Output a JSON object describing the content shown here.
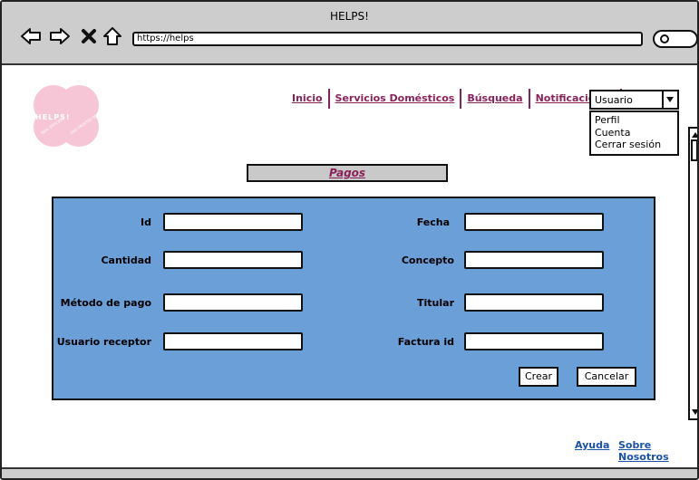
{
  "window": {
    "title": "HELPS!",
    "url": "https://helps"
  },
  "logo": {
    "text": "HELPS!",
    "tagline_left": "REAL EFFICIENT",
    "tagline_right": "AND TRUSTED SERVICE",
    "color": "#f7c6d6"
  },
  "nav": {
    "items": [
      {
        "label": "Inicio"
      },
      {
        "label": "Servicios Domésticos"
      },
      {
        "label": "Búsqueda"
      },
      {
        "label": "Notificaciones"
      }
    ]
  },
  "user_menu": {
    "selected": "Usuario",
    "options": [
      "Perfil",
      "Cuenta",
      "Cerrar sesión"
    ]
  },
  "page": {
    "title": "Pagos"
  },
  "form": {
    "fields": {
      "id": {
        "label": "Id",
        "value": ""
      },
      "cantidad": {
        "label": "Cantidad",
        "value": ""
      },
      "metodo_pago": {
        "label": "Método de pago",
        "value": ""
      },
      "usuario_receptor": {
        "label": "Usuario receptor",
        "value": ""
      },
      "fecha": {
        "label": "Fecha",
        "value": ""
      },
      "concepto": {
        "label": "Concepto",
        "value": ""
      },
      "titular": {
        "label": "Titular",
        "value": ""
      },
      "factura_id": {
        "label": "Factura id",
        "value": ""
      }
    },
    "buttons": {
      "create": "Crear",
      "cancel": "Cancelar"
    }
  },
  "footer": {
    "help": "Ayuda",
    "about": "Sobre Nosotros"
  },
  "colors": {
    "accent": "#8a2259",
    "panel": "#6a9fd7",
    "link": "#1a52a8",
    "chrome": "#cdcdcd"
  }
}
